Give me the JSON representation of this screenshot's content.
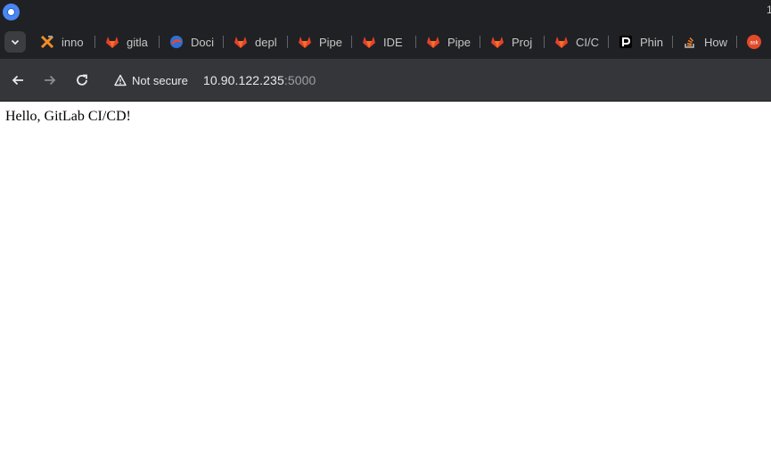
{
  "browser": {
    "tabs": [
      {
        "label": "inno",
        "icon": "x-logo-icon"
      },
      {
        "label": "gitla",
        "icon": "gitlab-icon"
      },
      {
        "label": "Doci",
        "icon": "docs-circle-icon"
      },
      {
        "label": "depl",
        "icon": "gitlab-icon"
      },
      {
        "label": "Pipe",
        "icon": "gitlab-icon"
      },
      {
        "label": "IDE",
        "icon": "gitlab-icon"
      },
      {
        "label": "Pipe",
        "icon": "gitlab-icon"
      },
      {
        "label": "Proj",
        "icon": "gitlab-icon"
      },
      {
        "label": "CI/C",
        "icon": "gitlab-icon"
      },
      {
        "label": "Phin",
        "icon": "p-square-icon"
      },
      {
        "label": "How",
        "icon": "stackoverflow-icon"
      },
      {
        "label": "",
        "icon": "ask-badge-icon",
        "badge_text": "ask"
      }
    ],
    "security_label": "Not secure",
    "url_host": "10.90.122.235",
    "url_port": ":5000",
    "corner_mark": "1"
  },
  "page": {
    "body_text": "Hello, GitLab CI/CD!"
  },
  "colors": {
    "gitlab_orange": "#e2432a",
    "chrome_dark": "#202124",
    "toolbar": "#35363a"
  }
}
